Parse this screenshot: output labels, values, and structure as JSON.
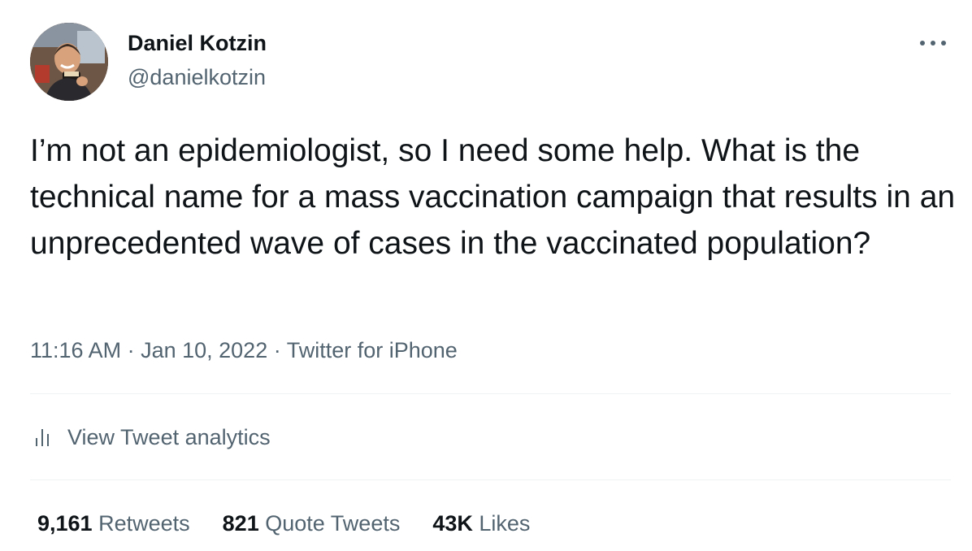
{
  "author": {
    "display_name": "Daniel Kotzin",
    "handle": "@danielkotzin"
  },
  "tweet": {
    "text": "I’m not an epidemiologist, so I need some help. What is the technical name for a mass vaccination campaign that results in an unprecedented wave of cases in the vaccinated population?",
    "time": "11:16 AM",
    "separator": " · ",
    "date": "Jan 10, 2022",
    "source": "Twitter for iPhone"
  },
  "analytics": {
    "label": "View Tweet analytics",
    "icon": "bar-chart-icon"
  },
  "stats": {
    "retweets_count": "9,161",
    "retweets_label": "Retweets",
    "quotes_count": "821",
    "quotes_label": "Quote Tweets",
    "likes_count": "43K",
    "likes_label": "Likes"
  },
  "icons": {
    "more": "more-horizontal-icon"
  },
  "colors": {
    "text_primary": "#0f1419",
    "text_secondary": "#536471",
    "divider": "#eff3f4"
  }
}
